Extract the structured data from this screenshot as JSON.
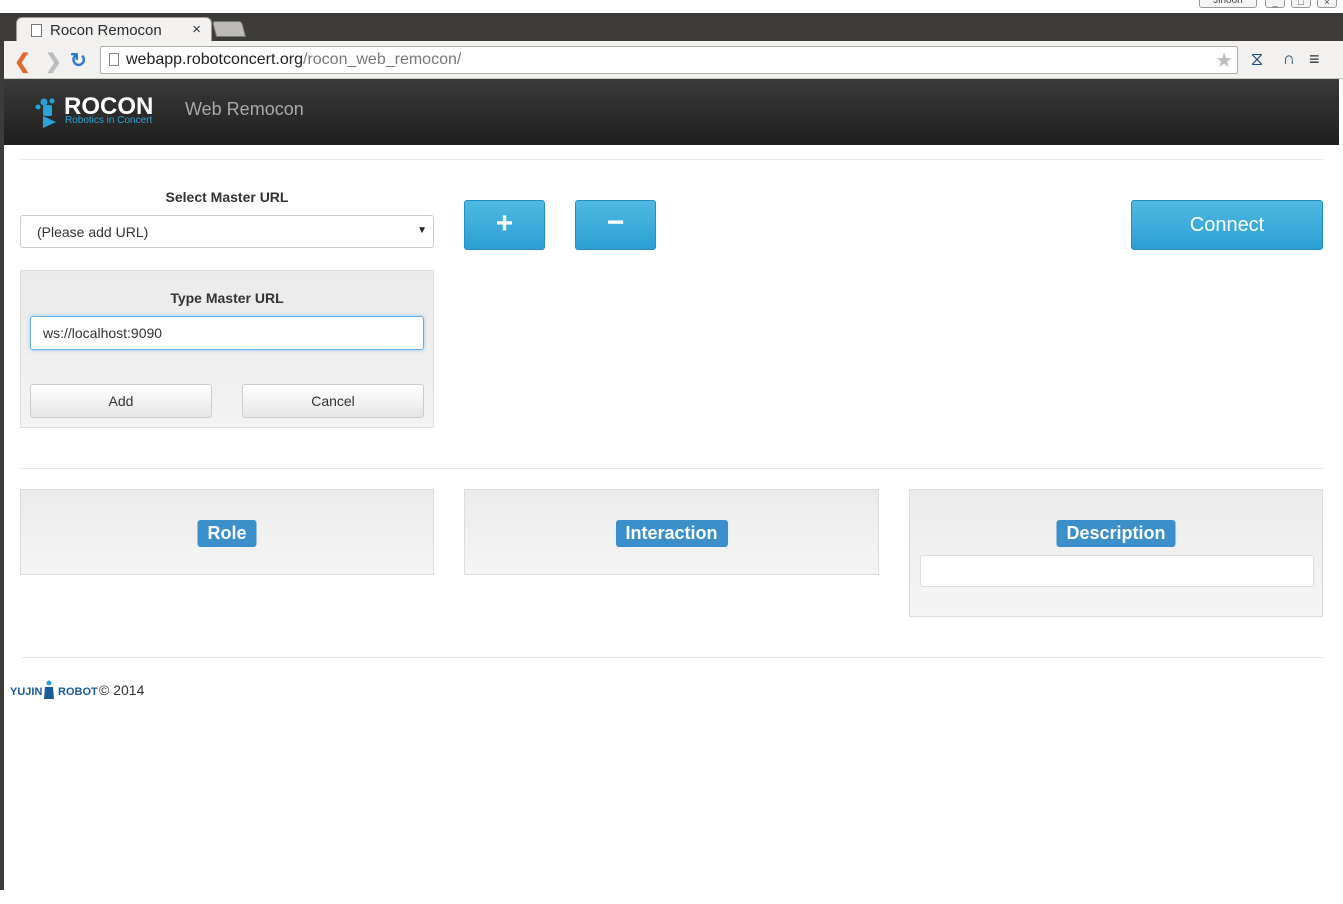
{
  "browser": {
    "tab_title": "Rocon Remocon",
    "tab_close": "×",
    "user_label": "Jihoon",
    "url_host": "webapp.robotconcert.org",
    "url_path": "/rocon_web_remocon/"
  },
  "header": {
    "logo_text": "ROCON",
    "logo_sub": "Robotics in Concert",
    "title": "Web Remocon",
    "accent": "#2aa3d8"
  },
  "master": {
    "select_label": "Select Master URL",
    "select_value": "(Please add URL)",
    "type_label": "Type Master URL",
    "input_value": "ws://localhost:9090",
    "add_label": "Add",
    "cancel_label": "Cancel",
    "plus_label": "+",
    "minus_label": "−",
    "connect_label": "Connect",
    "button_color": "#2a9fd3"
  },
  "panels": {
    "role_label": "Role",
    "interaction_label": "Interaction",
    "description_label": "Description",
    "badge_color": "#3b8fcb"
  },
  "footer": {
    "logo_left": "YUJIN",
    "logo_right": "ROBOT",
    "copyright": "© 2014"
  }
}
